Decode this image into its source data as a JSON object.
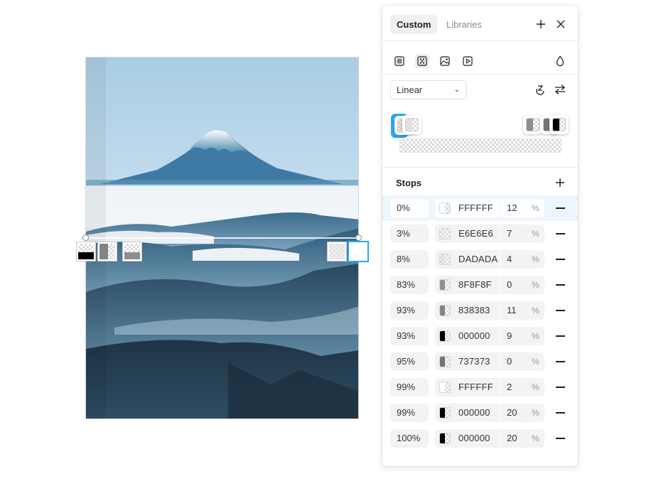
{
  "panel": {
    "tabs": [
      {
        "label": "Custom",
        "active": true
      },
      {
        "label": "Libraries",
        "active": false
      }
    ],
    "header_icons": [
      "add-icon",
      "close-icon"
    ],
    "fill_types": [
      "solid-fill-icon",
      "gradient-fill-icon",
      "image-fill-icon",
      "video-fill-icon"
    ],
    "selected_fill_type": "gradient-fill-icon",
    "eyedropper_icon": "eyedropper-icon",
    "gradient_type": "Linear",
    "gradient_tools": [
      "rotate-gradient-icon",
      "swap-direction-icon"
    ],
    "stops_label": "Stops",
    "percent_symbol": "%",
    "stops": [
      {
        "position": "0%",
        "hex": "FFFFFF",
        "opacity": "12",
        "color": "#FFFFFF",
        "alpha": 0.12,
        "selected": true
      },
      {
        "position": "3%",
        "hex": "E6E6E6",
        "opacity": "7",
        "color": "#E6E6E6",
        "alpha": 0.07,
        "selected": false
      },
      {
        "position": "8%",
        "hex": "DADADA",
        "opacity": "4",
        "color": "#DADADA",
        "alpha": 0.04,
        "selected": false
      },
      {
        "position": "83%",
        "hex": "8F8F8F",
        "opacity": "0",
        "color": "#8F8F8F",
        "alpha": 0.0,
        "selected": false
      },
      {
        "position": "93%",
        "hex": "838383",
        "opacity": "11",
        "color": "#838383",
        "alpha": 0.11,
        "selected": false
      },
      {
        "position": "93%",
        "hex": "000000",
        "opacity": "9",
        "color": "#000000",
        "alpha": 0.09,
        "selected": false
      },
      {
        "position": "95%",
        "hex": "737373",
        "opacity": "0",
        "color": "#737373",
        "alpha": 0.0,
        "selected": false
      },
      {
        "position": "99%",
        "hex": "FFFFFF",
        "opacity": "2",
        "color": "#FFFFFF",
        "alpha": 0.02,
        "selected": false
      },
      {
        "position": "99%",
        "hex": "000000",
        "opacity": "20",
        "color": "#000000",
        "alpha": 0.2,
        "selected": false
      },
      {
        "position": "100%",
        "hex": "000000",
        "opacity": "20",
        "color": "#000000",
        "alpha": 0.2,
        "selected": false
      }
    ]
  },
  "canvas": {
    "artwork": "mountain-landscape-image",
    "accent": "#2BA8F5"
  }
}
